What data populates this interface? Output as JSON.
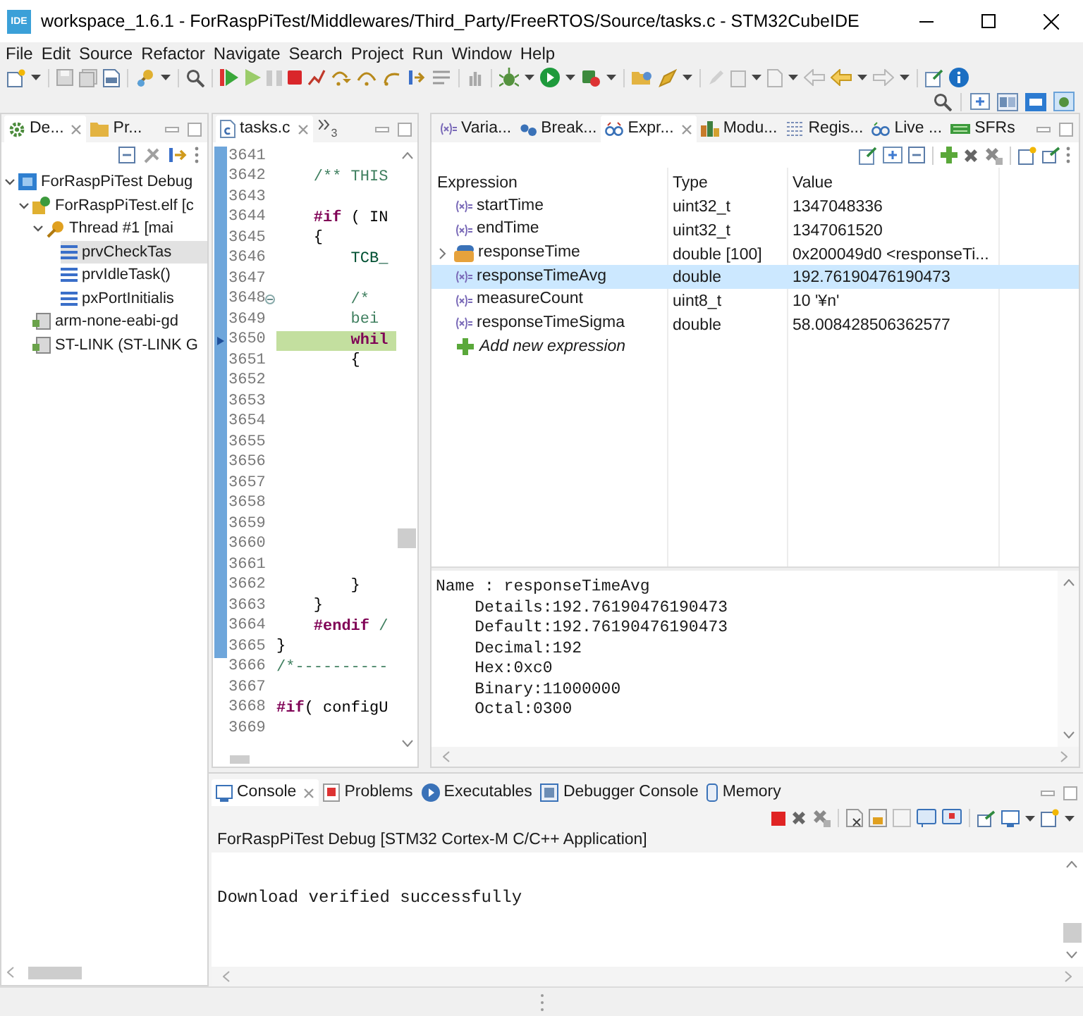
{
  "window": {
    "app_badge": "IDE",
    "title": "workspace_1.6.1 - ForRaspPiTest/Middlewares/Third_Party/FreeRTOS/Source/tasks.c - STM32CubeIDE"
  },
  "menu": [
    "File",
    "Edit",
    "Source",
    "Refactor",
    "Navigate",
    "Search",
    "Project",
    "Run",
    "Window",
    "Help"
  ],
  "debug_view": {
    "tabs": [
      {
        "label": "De...",
        "selected": true
      },
      {
        "label": "Pr...",
        "selected": false
      }
    ],
    "tree": [
      {
        "label": "ForRaspPiTest Debug",
        "kind": "launch",
        "expanded": true,
        "selected": false,
        "children": [
          {
            "label": "ForRaspPiTest.elf [c",
            "kind": "process",
            "expanded": true,
            "selected": false,
            "children": [
              {
                "label": "Thread #1 [mai",
                "kind": "thread",
                "expanded": true,
                "selected": false,
                "children": [
                  {
                    "label": "prvCheckTas",
                    "kind": "frame",
                    "selected": true
                  },
                  {
                    "label": "prvIdleTask()",
                    "kind": "frame",
                    "selected": false
                  },
                  {
                    "label": "pxPortInitialis",
                    "kind": "frame",
                    "selected": false
                  }
                ]
              }
            ]
          },
          {
            "label": "arm-none-eabi-gd",
            "kind": "target",
            "selected": false
          },
          {
            "label": "ST-LINK (ST-LINK G",
            "kind": "target",
            "selected": false
          }
        ]
      }
    ]
  },
  "editor": {
    "tabs": [
      {
        "label": "tasks.c",
        "selected": true
      }
    ],
    "hidden_count": "3",
    "lines": [
      {
        "n": "3641",
        "range": true,
        "current": false
      },
      {
        "n": "3642",
        "range": true,
        "current": false,
        "tokens": [
          {
            "text": "    /** THIS",
            "kind": "comment"
          }
        ]
      },
      {
        "n": "3643",
        "range": true,
        "current": false
      },
      {
        "n": "3644",
        "range": true,
        "current": false,
        "tokens": [
          {
            "text": "    #if",
            "kind": "keyword"
          },
          {
            "text": " ( IN",
            "kind": "plain"
          }
        ]
      },
      {
        "n": "3645",
        "range": true,
        "current": false,
        "tokens": [
          {
            "text": "    {",
            "kind": "plain"
          }
        ]
      },
      {
        "n": "3646",
        "range": true,
        "current": false,
        "tokens": [
          {
            "text": "        TCB_",
            "kind": "type"
          }
        ]
      },
      {
        "n": "3647",
        "range": true,
        "current": false
      },
      {
        "n": "3648",
        "range": true,
        "current": false,
        "fold_collapsed": false,
        "tokens": [
          {
            "text": "        /*",
            "kind": "comment"
          }
        ]
      },
      {
        "n": "3649",
        "range": true,
        "current": false,
        "tokens": [
          {
            "text": "        bei",
            "kind": "comment"
          }
        ]
      },
      {
        "n": "3650",
        "range": true,
        "current": true,
        "tokens": [
          {
            "text": "        whil",
            "kind": "keyword"
          }
        ]
      },
      {
        "n": "3651",
        "range": true,
        "current": false,
        "tokens": [
          {
            "text": "        {",
            "kind": "plain"
          }
        ]
      },
      {
        "n": "3652",
        "range": true,
        "current": false
      },
      {
        "n": "3653",
        "range": true,
        "current": false
      },
      {
        "n": "3654",
        "range": true,
        "current": false
      },
      {
        "n": "3655",
        "range": true,
        "current": false
      },
      {
        "n": "3656",
        "range": true,
        "current": false
      },
      {
        "n": "3657",
        "range": true,
        "current": false
      },
      {
        "n": "3658",
        "range": true,
        "current": false
      },
      {
        "n": "3659",
        "range": true,
        "current": false
      },
      {
        "n": "3660",
        "range": true,
        "current": false
      },
      {
        "n": "3661",
        "range": true,
        "current": false
      },
      {
        "n": "3662",
        "range": true,
        "current": false,
        "tokens": [
          {
            "text": "        }",
            "kind": "plain"
          }
        ]
      },
      {
        "n": "3663",
        "range": true,
        "current": false,
        "tokens": [
          {
            "text": "    }",
            "kind": "plain"
          }
        ]
      },
      {
        "n": "3664",
        "range": true,
        "current": false,
        "tokens": [
          {
            "text": "    #endif",
            "kind": "keyword"
          },
          {
            "text": " /",
            "kind": "comment"
          }
        ]
      },
      {
        "n": "3665",
        "range": true,
        "current": false,
        "tokens": [
          {
            "text": "}",
            "kind": "plain"
          }
        ]
      },
      {
        "n": "3666",
        "range": false,
        "current": false,
        "tokens": [
          {
            "text": "/*----------",
            "kind": "comment"
          }
        ]
      },
      {
        "n": "3667",
        "range": false,
        "current": false
      },
      {
        "n": "3668",
        "range": false,
        "current": false,
        "tokens": [
          {
            "text": "#if",
            "kind": "keyword"
          },
          {
            "text": "( configU",
            "kind": "plain"
          }
        ]
      },
      {
        "n": "3669",
        "range": false,
        "current": false
      }
    ]
  },
  "expressions": {
    "tabs": [
      {
        "label": "Varia...",
        "selected": false
      },
      {
        "label": "Break...",
        "selected": false
      },
      {
        "label": "Expr...",
        "selected": true
      },
      {
        "label": "Modu...",
        "selected": false
      },
      {
        "label": "Regis...",
        "selected": false
      },
      {
        "label": "Live ...",
        "selected": false
      },
      {
        "label": "SFRs",
        "selected": false
      }
    ],
    "columns": [
      "Expression",
      "Type",
      "Value"
    ],
    "rows": [
      {
        "kind": "variable",
        "name": "startTime",
        "type": "uint32_t",
        "value": "1347048336",
        "selected": false
      },
      {
        "kind": "variable",
        "name": "endTime",
        "type": "uint32_t",
        "value": "1347061520",
        "selected": false
      },
      {
        "kind": "array",
        "name": "responseTime",
        "type": "double [100]",
        "value": "0x200049d0 <responseTi...",
        "expanded": false,
        "selected": false
      },
      {
        "kind": "variable",
        "name": "responseTimeAvg",
        "type": "double",
        "value": "192.76190476190473",
        "selected": true
      },
      {
        "kind": "variable",
        "name": "measureCount",
        "type": "uint8_t",
        "value": "10 '¥n'",
        "selected": false
      },
      {
        "kind": "variable",
        "name": "responseTimeSigma",
        "type": "double",
        "value": "58.008428506362577",
        "selected": false
      }
    ],
    "add_row": "Add new expression",
    "details": {
      "header": "Name : responseTimeAvg",
      "lines": [
        "Details:192.76190476190473",
        "Default:192.76190476190473",
        "Decimal:192",
        "Hex:0xc0",
        "Binary:11000000",
        "Octal:0300"
      ]
    }
  },
  "console": {
    "tabs": [
      {
        "label": "Console",
        "selected": true
      },
      {
        "label": "Problems",
        "selected": false
      },
      {
        "label": "Executables",
        "selected": false
      },
      {
        "label": "Debugger Console",
        "selected": false
      },
      {
        "label": "Memory",
        "selected": false
      }
    ],
    "header": "ForRaspPiTest Debug [STM32 Cortex-M C/C++ Application]",
    "output": [
      "Download verified successfully"
    ]
  }
}
